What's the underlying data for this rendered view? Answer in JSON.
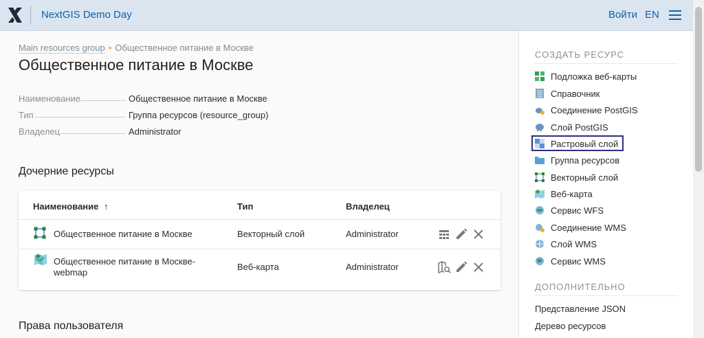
{
  "header": {
    "app_title": "NextGIS Demo Day",
    "login_label": "Войти",
    "language": "EN",
    "brand_color": "#0f61a8"
  },
  "breadcrumb": {
    "parent": "Main resources group",
    "current": "Общественное питание в Москве"
  },
  "page_title": "Общественное питание в Москве",
  "properties": [
    {
      "key": "Наименование",
      "value": "Общественное питание в Москве"
    },
    {
      "key": "Тип",
      "value": "Группа ресурсов (resource_group)"
    },
    {
      "key": "Владелец",
      "value": "Administrator"
    }
  ],
  "children_section": {
    "title": "Дочерние ресурсы",
    "columns": {
      "name": "Наименование",
      "type": "Тип",
      "owner": "Владелец"
    },
    "sort_indicator": "↑",
    "rows": [
      {
        "name": "Общественное питание в Москве",
        "type": "Векторный слой",
        "owner": "Administrator",
        "icon": "vector-layer-icon"
      },
      {
        "name_line1": "Общественное питание в Москве-",
        "name_line2": "webmap",
        "type": "Веб-карта",
        "owner": "Administrator",
        "icon": "webmap-icon"
      }
    ]
  },
  "permissions_section": {
    "title": "Права пользователя"
  },
  "sidebar": {
    "create_title": "СОЗДАТЬ РЕСУРС",
    "create_items": [
      {
        "label": "Подложка веб-карты",
        "icon": "basemap-icon"
      },
      {
        "label": "Справочник",
        "icon": "lookup-table-icon"
      },
      {
        "label": "Соединение PostGIS",
        "icon": "postgis-connection-icon"
      },
      {
        "label": "Слой PostGIS",
        "icon": "postgis-layer-icon"
      },
      {
        "label": "Растровый слой",
        "icon": "raster-layer-icon",
        "selected": true
      },
      {
        "label": "Группа ресурсов",
        "icon": "folder-icon"
      },
      {
        "label": "Векторный слой",
        "icon": "vector-layer-icon"
      },
      {
        "label": "Веб-карта",
        "icon": "webmap-icon"
      },
      {
        "label": "Сервис WFS",
        "icon": "wfs-service-icon"
      },
      {
        "label": "Соединение WMS",
        "icon": "wms-connection-icon"
      },
      {
        "label": "Слой WMS",
        "icon": "wms-layer-icon"
      },
      {
        "label": "Сервис WMS",
        "icon": "wms-service-icon"
      }
    ],
    "extra_title": "ДОПОЛНИТЕЛЬНО",
    "extra_items": [
      {
        "label": "Представление JSON"
      },
      {
        "label": "Дерево ресурсов"
      }
    ],
    "selection_color": "#2b2e7d"
  }
}
